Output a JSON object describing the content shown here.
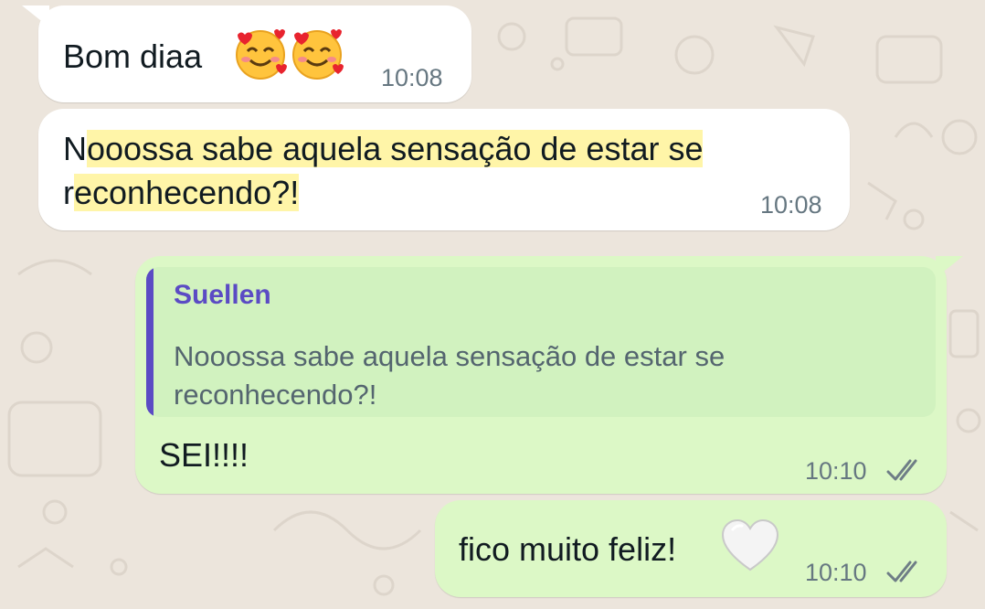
{
  "messages": [
    {
      "type": "incoming",
      "text": "Bom diaa",
      "emoji": [
        "smiling-face-with-hearts",
        "smiling-face-with-hearts"
      ],
      "time": "10:08"
    },
    {
      "type": "incoming",
      "first_letter_1": "N",
      "highlight_1": "ooossa sabe aquela sensação de estar se",
      "first_letter_2": "r",
      "highlight_2": "econhecendo?!",
      "time": "10:08"
    },
    {
      "type": "outgoing",
      "quote": {
        "author": "Suellen",
        "line1": "Nooossa sabe aquela sensação de estar se",
        "line2": "reconhecendo?!"
      },
      "text": "SEI!!!!",
      "time": "10:10",
      "status": "read"
    },
    {
      "type": "outgoing",
      "text": "fico muito feliz!",
      "emoji": [
        "white-heart"
      ],
      "time": "10:10",
      "status": "read"
    }
  ],
  "colors": {
    "background": "#ece5dc",
    "incoming_bubble": "#ffffff",
    "outgoing_bubble": "#dcf8c6",
    "quote_bar": "#5b4bc4",
    "highlight": "#fff5a8",
    "timestamp": "#667781"
  }
}
